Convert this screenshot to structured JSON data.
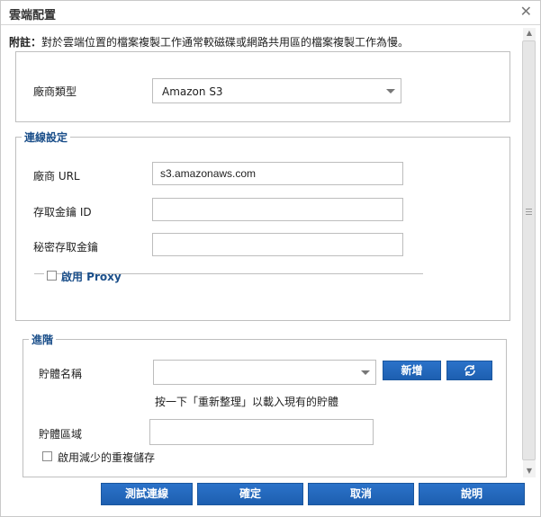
{
  "dialog": {
    "title": "雲端配置"
  },
  "note": {
    "prefix": "附註：",
    "text": "對於雲端位置的檔案複製工作通常較磁碟或網路共用區的檔案複製工作為慢。"
  },
  "vendor": {
    "label": "廠商類型",
    "selected": "Amazon S3"
  },
  "connection": {
    "legend": "連線設定",
    "url_label": "廠商 URL",
    "url_value": "s3.amazonaws.com",
    "access_key_label": "存取金鑰 ID",
    "access_key_value": "",
    "secret_key_label": "秘密存取金鑰",
    "secret_key_value": "",
    "proxy_label": "啟用 Proxy",
    "proxy_checked": false
  },
  "advanced": {
    "legend": "進階",
    "bucket_label": "貯體名稱",
    "bucket_value": "",
    "add_button": "新增",
    "refresh_icon": "refresh-icon",
    "hint": "按一下「重新整理」以載入現有的貯體",
    "region_label": "貯體區域",
    "region_value": "",
    "dedup_label": "啟用減少的重複儲存",
    "dedup_checked": false
  },
  "buttons": {
    "test": "測試連線",
    "ok": "確定",
    "cancel": "取消",
    "help": "說明"
  },
  "colors": {
    "accent": "#1d5fb0",
    "legend": "#1b4f8a"
  }
}
